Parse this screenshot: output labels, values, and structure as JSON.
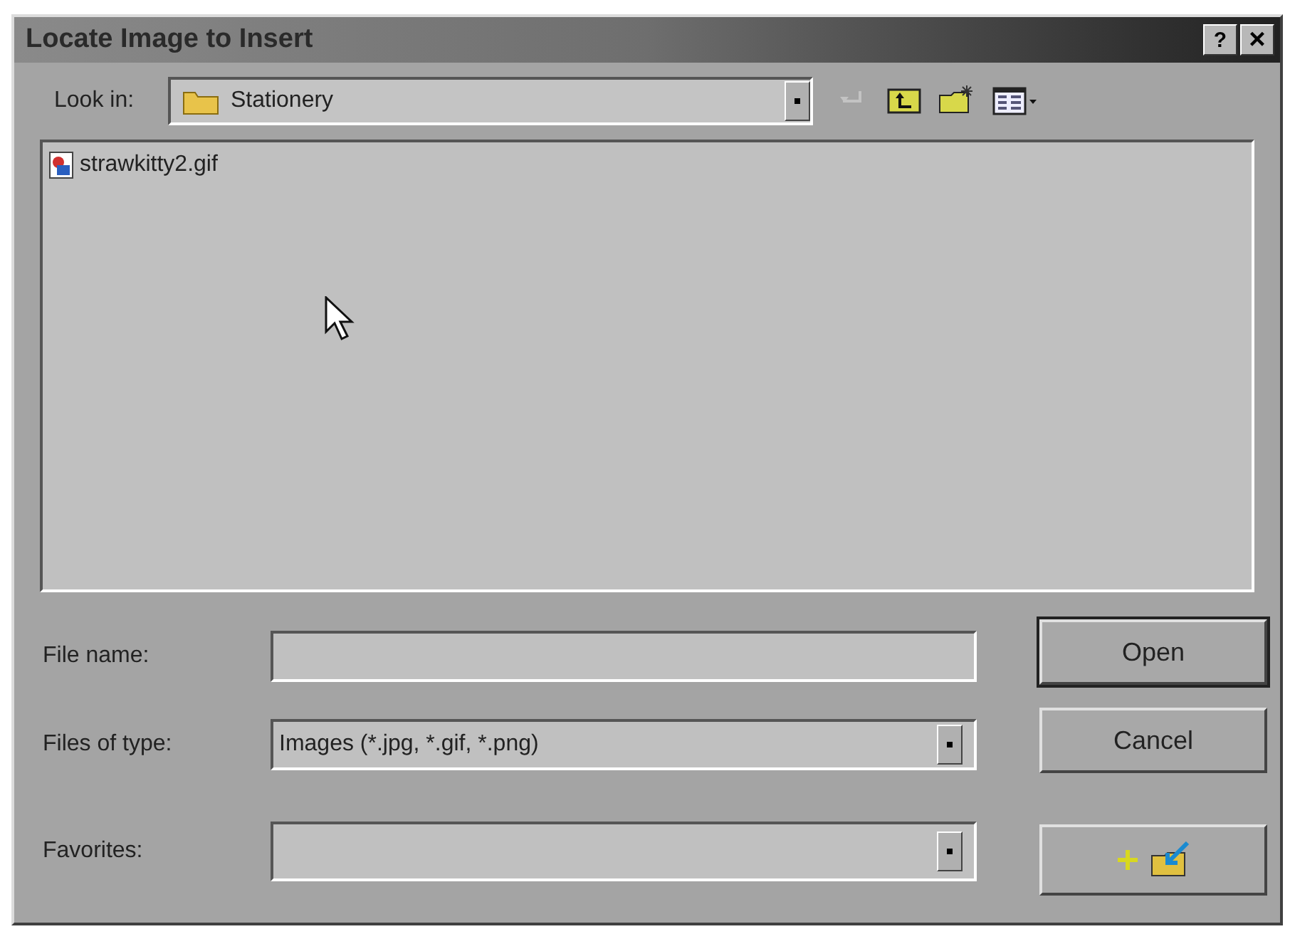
{
  "window": {
    "title": "Locate Image to Insert",
    "help_glyph": "?",
    "close_glyph": "×"
  },
  "look_in": {
    "label": "Look in:",
    "value": "Stationery"
  },
  "toolbar": [
    {
      "kind": "back",
      "disabled": true
    },
    {
      "kind": "up",
      "disabled": false
    },
    {
      "kind": "newfolder",
      "disabled": false
    },
    {
      "kind": "views",
      "disabled": false
    }
  ],
  "files": [
    {
      "name": "strawkitty2.gif",
      "selected": false
    }
  ],
  "file_name": {
    "label": "File name:"
  },
  "files_of_type": {
    "label": "Files of type:",
    "value": "Images (*.jpg, *.gif, *.png)"
  },
  "favorites": {
    "label": "Favorites:"
  },
  "buttons": [
    {
      "kind": "text",
      "label": "Open",
      "default": true
    },
    {
      "kind": "text",
      "label": "Cancel",
      "default": false
    },
    {
      "kind": "add-favorite"
    }
  ]
}
